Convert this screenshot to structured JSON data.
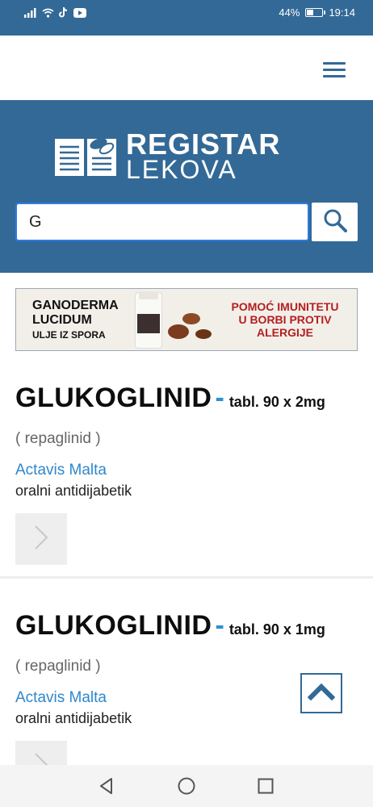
{
  "status_bar": {
    "battery": "44%",
    "battery_level": 0.44,
    "time": "19:14",
    "icons": [
      "signal-icon",
      "wifi-icon",
      "tiktok-icon",
      "youtube-icon"
    ]
  },
  "header": {
    "menu_icon": "hamburger-menu-icon"
  },
  "hero": {
    "logo_line1": "REGISTAR",
    "logo_line2": "LEKOVA",
    "search": {
      "value": "G",
      "placeholder": ""
    }
  },
  "banner": {
    "left_line1": "GANODERMA",
    "left_line2": "LUCIDUM",
    "left_line3": "ULJE IZ SPORA",
    "right_line1": "POMOĆ IMUNITETU",
    "right_line2": "U BORBI PROTIV",
    "right_line3": "ALERGIJE"
  },
  "products": [
    {
      "name": "GLUKOGLINID",
      "dash": "-",
      "form": "tabl. 90 x 2mg",
      "substance": "( repaglinid )",
      "maker": "Actavis Malta",
      "group": "oralni antidijabetik"
    },
    {
      "name": "GLUKOGLINID",
      "dash": "-",
      "form": "tabl. 90 x 1mg",
      "substance": "( repaglinid )",
      "maker": "Actavis Malta",
      "group": "oralni antidijabetik"
    }
  ],
  "colors": {
    "brand": "#336996",
    "link": "#2e87cc",
    "accent_dash": "#2d8fd6",
    "banner_red": "#b41f1f"
  }
}
